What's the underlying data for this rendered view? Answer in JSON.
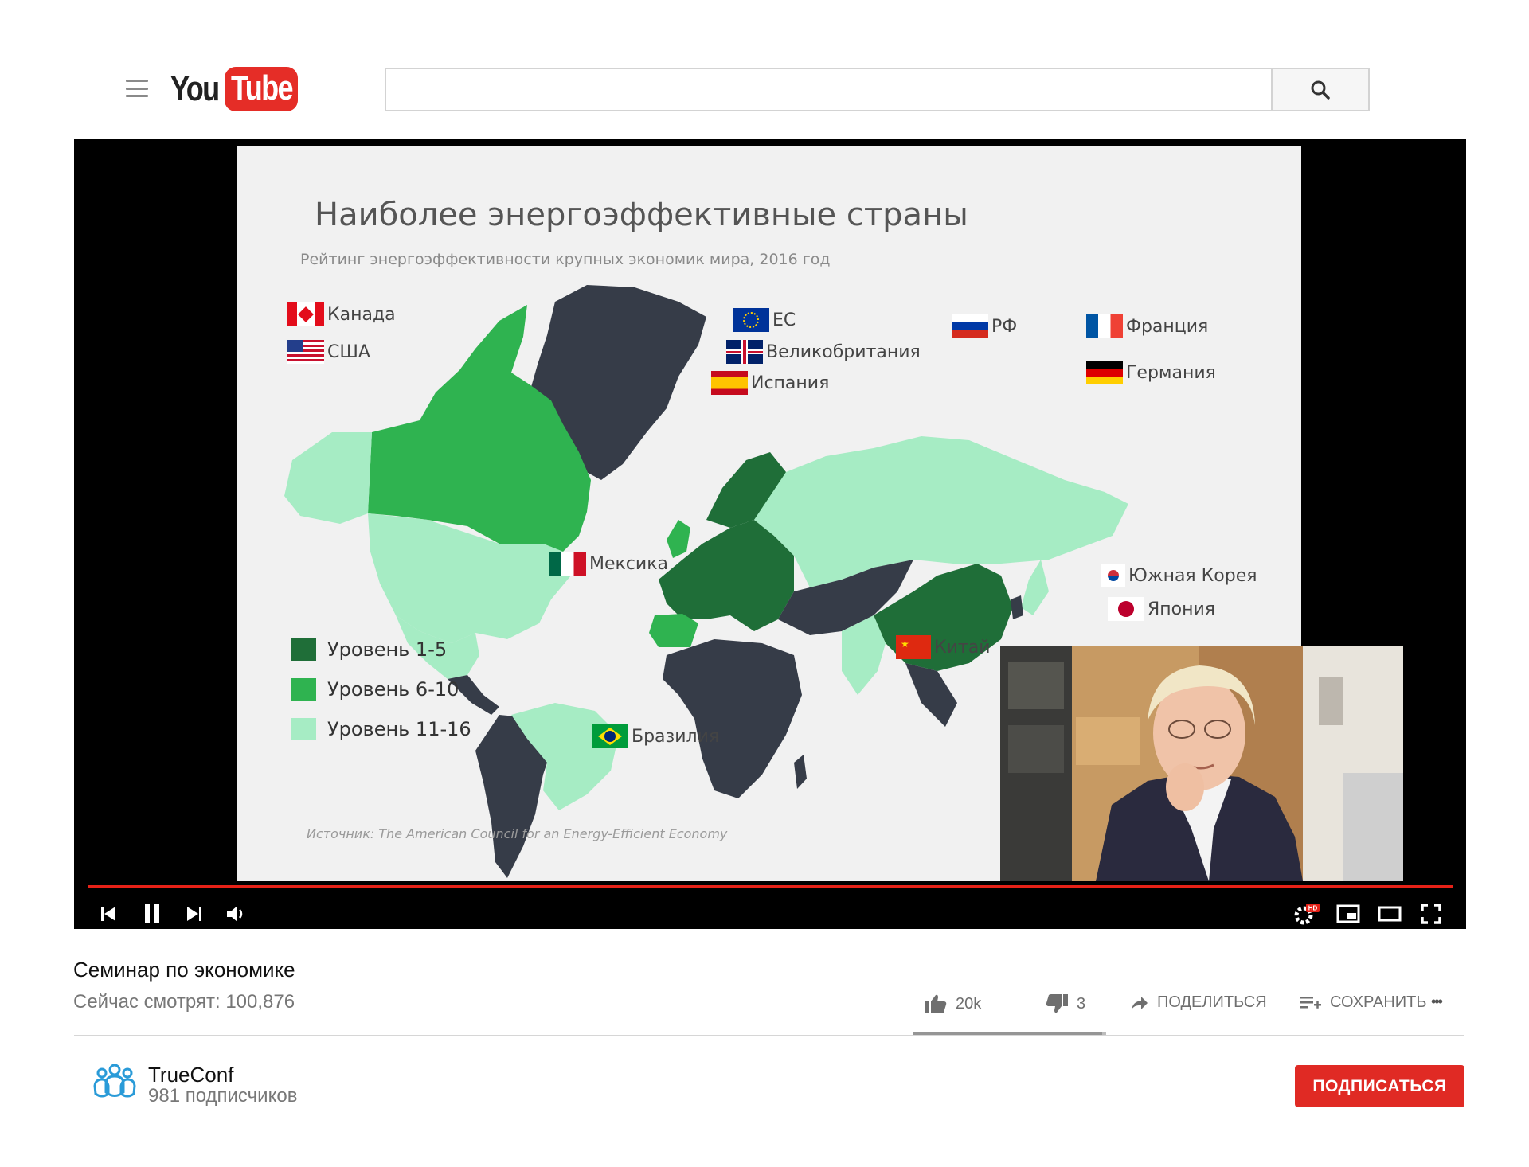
{
  "header": {
    "logo_you": "You",
    "logo_tube": "Tube",
    "search_placeholder": "",
    "search_value": ""
  },
  "slide": {
    "title": "Наиболее энергоэффективные страны",
    "subtitle": "Рейтинг энергоэффективности крупных экономик мира, 2016 год",
    "source": "Источник: The American Council  for an Energy-Efficient  Economy",
    "countries": {
      "canada": "Канада",
      "usa": "США",
      "eu": "ЕС",
      "uk": "Великобритания",
      "spain": "Испания",
      "russia": "РФ",
      "france": "Франция",
      "germany": "Германия",
      "mexico": "Мексика",
      "korea": "Южная Корея",
      "japan": "Япония",
      "china": "Китай",
      "brazil": "Бразилия"
    },
    "legend": [
      {
        "label": "Уровень 1-5",
        "color": "#1f6e38"
      },
      {
        "label": "Уровень 6-10",
        "color": "#2fb350"
      },
      {
        "label": "Уровень 11-16",
        "color": "#a6ecc4"
      }
    ],
    "colors": {
      "background": "#f1f1f1",
      "land_default": "#363c48",
      "tier1": "#1f6e38",
      "tier2": "#2fb350",
      "tier3": "#a6ecc4"
    }
  },
  "player": {
    "progress_fraction": 1.0,
    "accent": "#e62117",
    "controls": [
      "previous-icon",
      "pause-icon",
      "next-icon",
      "volume-icon",
      "settings-icon",
      "miniplayer-icon",
      "theater-icon",
      "fullscreen-icon"
    ],
    "hd_badge": "HD"
  },
  "video": {
    "title": "Семинар по экономике",
    "views": "Сейчас смотрят: 100,876",
    "likes": "20k",
    "dislikes": "3",
    "share_label": "ПОДЕЛИТЬСЯ",
    "save_label": "СОХРАНИТЬ",
    "more_label": "•••",
    "like_ratio": 0.98
  },
  "channel": {
    "name": "TrueConf",
    "subscribers": "981 подписчиков",
    "subscribe_label": "ПОДПИСАТЬСЯ",
    "subscribe_color": "#e02a24"
  }
}
